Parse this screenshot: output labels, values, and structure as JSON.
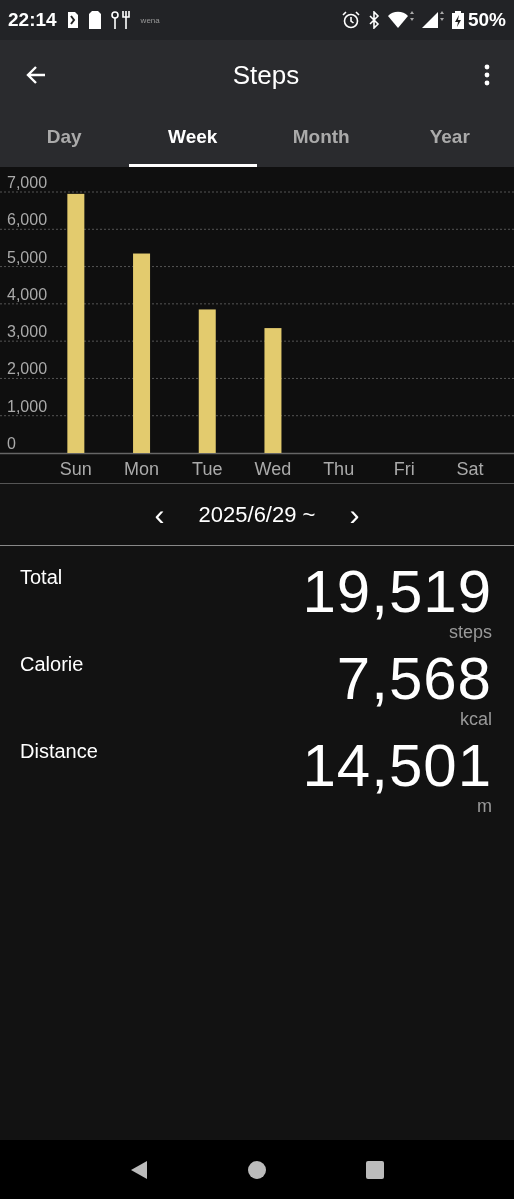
{
  "status_bar": {
    "time": "22:14",
    "app_label": "wena",
    "battery": "50%"
  },
  "app_bar": {
    "title": "Steps"
  },
  "tabs": [
    {
      "label": "Day",
      "selected": false
    },
    {
      "label": "Week",
      "selected": true
    },
    {
      "label": "Month",
      "selected": false
    },
    {
      "label": "Year",
      "selected": false
    }
  ],
  "chart": {
    "chart_data": {
      "type": "bar",
      "categories": [
        "Sun",
        "Mon",
        "Tue",
        "Wed",
        "Thu",
        "Fri",
        "Sat"
      ],
      "series": [
        {
          "color": "#e3cb6e",
          "values": [
            6950,
            5350,
            3850,
            3350,
            null,
            null,
            null
          ]
        }
      ],
      "grid": true,
      "ylim": [
        0,
        7000
      ],
      "yticks": [
        {
          "value": 0,
          "label": "0"
        },
        {
          "value": 1000,
          "label": "1,000"
        },
        {
          "value": 2000,
          "label": "2,000"
        },
        {
          "value": 3000,
          "label": "3,000"
        },
        {
          "value": 4000,
          "label": "4,000"
        },
        {
          "value": 5000,
          "label": "5,000"
        },
        {
          "value": 6000,
          "label": "6,000"
        },
        {
          "value": 7000,
          "label": "7,000"
        }
      ]
    }
  },
  "date_nav": {
    "prev": "‹",
    "label": "2025/6/29 ~",
    "next": "›"
  },
  "stats": [
    {
      "label": "Total",
      "value": "19,519",
      "unit": "steps"
    },
    {
      "label": "Calorie",
      "value": "7,568",
      "unit": "kcal"
    },
    {
      "label": "Distance",
      "value": "14,501",
      "unit": "m"
    }
  ]
}
